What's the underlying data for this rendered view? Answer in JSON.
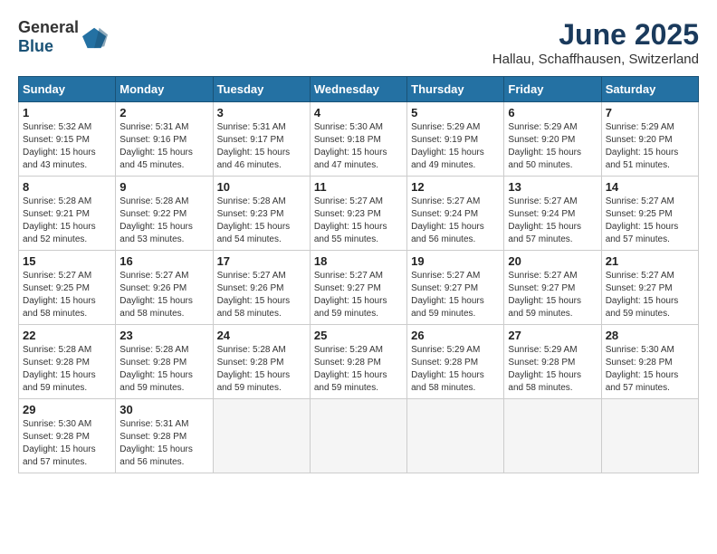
{
  "logo": {
    "general": "General",
    "blue": "Blue"
  },
  "title": "June 2025",
  "subtitle": "Hallau, Schaffhausen, Switzerland",
  "headers": [
    "Sunday",
    "Monday",
    "Tuesday",
    "Wednesday",
    "Thursday",
    "Friday",
    "Saturday"
  ],
  "weeks": [
    [
      {
        "day": "1",
        "sunrise": "Sunrise: 5:32 AM",
        "sunset": "Sunset: 9:15 PM",
        "daylight": "Daylight: 15 hours and 43 minutes."
      },
      {
        "day": "2",
        "sunrise": "Sunrise: 5:31 AM",
        "sunset": "Sunset: 9:16 PM",
        "daylight": "Daylight: 15 hours and 45 minutes."
      },
      {
        "day": "3",
        "sunrise": "Sunrise: 5:31 AM",
        "sunset": "Sunset: 9:17 PM",
        "daylight": "Daylight: 15 hours and 46 minutes."
      },
      {
        "day": "4",
        "sunrise": "Sunrise: 5:30 AM",
        "sunset": "Sunset: 9:18 PM",
        "daylight": "Daylight: 15 hours and 47 minutes."
      },
      {
        "day": "5",
        "sunrise": "Sunrise: 5:29 AM",
        "sunset": "Sunset: 9:19 PM",
        "daylight": "Daylight: 15 hours and 49 minutes."
      },
      {
        "day": "6",
        "sunrise": "Sunrise: 5:29 AM",
        "sunset": "Sunset: 9:20 PM",
        "daylight": "Daylight: 15 hours and 50 minutes."
      },
      {
        "day": "7",
        "sunrise": "Sunrise: 5:29 AM",
        "sunset": "Sunset: 9:20 PM",
        "daylight": "Daylight: 15 hours and 51 minutes."
      }
    ],
    [
      {
        "day": "8",
        "sunrise": "Sunrise: 5:28 AM",
        "sunset": "Sunset: 9:21 PM",
        "daylight": "Daylight: 15 hours and 52 minutes."
      },
      {
        "day": "9",
        "sunrise": "Sunrise: 5:28 AM",
        "sunset": "Sunset: 9:22 PM",
        "daylight": "Daylight: 15 hours and 53 minutes."
      },
      {
        "day": "10",
        "sunrise": "Sunrise: 5:28 AM",
        "sunset": "Sunset: 9:23 PM",
        "daylight": "Daylight: 15 hours and 54 minutes."
      },
      {
        "day": "11",
        "sunrise": "Sunrise: 5:27 AM",
        "sunset": "Sunset: 9:23 PM",
        "daylight": "Daylight: 15 hours and 55 minutes."
      },
      {
        "day": "12",
        "sunrise": "Sunrise: 5:27 AM",
        "sunset": "Sunset: 9:24 PM",
        "daylight": "Daylight: 15 hours and 56 minutes."
      },
      {
        "day": "13",
        "sunrise": "Sunrise: 5:27 AM",
        "sunset": "Sunset: 9:24 PM",
        "daylight": "Daylight: 15 hours and 57 minutes."
      },
      {
        "day": "14",
        "sunrise": "Sunrise: 5:27 AM",
        "sunset": "Sunset: 9:25 PM",
        "daylight": "Daylight: 15 hours and 57 minutes."
      }
    ],
    [
      {
        "day": "15",
        "sunrise": "Sunrise: 5:27 AM",
        "sunset": "Sunset: 9:25 PM",
        "daylight": "Daylight: 15 hours and 58 minutes."
      },
      {
        "day": "16",
        "sunrise": "Sunrise: 5:27 AM",
        "sunset": "Sunset: 9:26 PM",
        "daylight": "Daylight: 15 hours and 58 minutes."
      },
      {
        "day": "17",
        "sunrise": "Sunrise: 5:27 AM",
        "sunset": "Sunset: 9:26 PM",
        "daylight": "Daylight: 15 hours and 58 minutes."
      },
      {
        "day": "18",
        "sunrise": "Sunrise: 5:27 AM",
        "sunset": "Sunset: 9:27 PM",
        "daylight": "Daylight: 15 hours and 59 minutes."
      },
      {
        "day": "19",
        "sunrise": "Sunrise: 5:27 AM",
        "sunset": "Sunset: 9:27 PM",
        "daylight": "Daylight: 15 hours and 59 minutes."
      },
      {
        "day": "20",
        "sunrise": "Sunrise: 5:27 AM",
        "sunset": "Sunset: 9:27 PM",
        "daylight": "Daylight: 15 hours and 59 minutes."
      },
      {
        "day": "21",
        "sunrise": "Sunrise: 5:27 AM",
        "sunset": "Sunset: 9:27 PM",
        "daylight": "Daylight: 15 hours and 59 minutes."
      }
    ],
    [
      {
        "day": "22",
        "sunrise": "Sunrise: 5:28 AM",
        "sunset": "Sunset: 9:28 PM",
        "daylight": "Daylight: 15 hours and 59 minutes."
      },
      {
        "day": "23",
        "sunrise": "Sunrise: 5:28 AM",
        "sunset": "Sunset: 9:28 PM",
        "daylight": "Daylight: 15 hours and 59 minutes."
      },
      {
        "day": "24",
        "sunrise": "Sunrise: 5:28 AM",
        "sunset": "Sunset: 9:28 PM",
        "daylight": "Daylight: 15 hours and 59 minutes."
      },
      {
        "day": "25",
        "sunrise": "Sunrise: 5:29 AM",
        "sunset": "Sunset: 9:28 PM",
        "daylight": "Daylight: 15 hours and 59 minutes."
      },
      {
        "day": "26",
        "sunrise": "Sunrise: 5:29 AM",
        "sunset": "Sunset: 9:28 PM",
        "daylight": "Daylight: 15 hours and 58 minutes."
      },
      {
        "day": "27",
        "sunrise": "Sunrise: 5:29 AM",
        "sunset": "Sunset: 9:28 PM",
        "daylight": "Daylight: 15 hours and 58 minutes."
      },
      {
        "day": "28",
        "sunrise": "Sunrise: 5:30 AM",
        "sunset": "Sunset: 9:28 PM",
        "daylight": "Daylight: 15 hours and 57 minutes."
      }
    ],
    [
      {
        "day": "29",
        "sunrise": "Sunrise: 5:30 AM",
        "sunset": "Sunset: 9:28 PM",
        "daylight": "Daylight: 15 hours and 57 minutes."
      },
      {
        "day": "30",
        "sunrise": "Sunrise: 5:31 AM",
        "sunset": "Sunset: 9:28 PM",
        "daylight": "Daylight: 15 hours and 56 minutes."
      },
      null,
      null,
      null,
      null,
      null
    ]
  ]
}
